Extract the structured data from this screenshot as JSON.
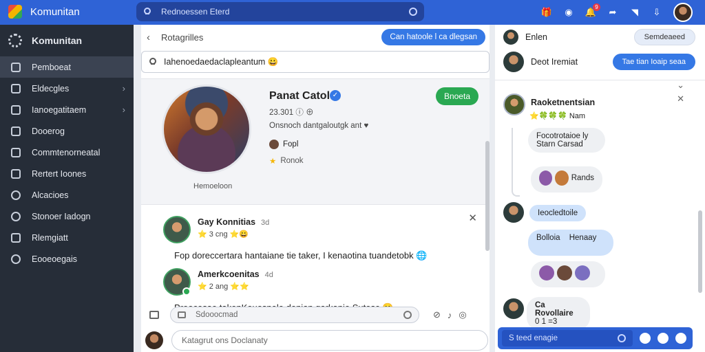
{
  "app": {
    "title": "Komunitan"
  },
  "search": {
    "placeholder": "Rednoessen Eterd"
  },
  "topbar": {
    "icons": [
      "gift-icon",
      "camera-icon",
      "notification-icon",
      "share-icon",
      "bookmark-icon",
      "download-icon"
    ],
    "notification_count": "9"
  },
  "sidebar": {
    "brand": "Komunitan",
    "items": [
      {
        "label": "Pemboeat",
        "icon": "home-icon"
      },
      {
        "label": "Eldecgles",
        "icon": "tag-icon",
        "chevron": "›"
      },
      {
        "label": "Ianoegatitaem",
        "icon": "calendar-icon",
        "chevron": "›"
      },
      {
        "label": "Dooerog",
        "icon": "chat-icon"
      },
      {
        "label": "Commtenorneatal",
        "icon": "video-icon"
      },
      {
        "label": "Rertert Ioones",
        "icon": "grid-icon"
      },
      {
        "label": "Alcacioes",
        "icon": "drop-icon"
      },
      {
        "label": "Stonoer Iadogn",
        "icon": "settings-icon"
      },
      {
        "label": "Rlemgiatt",
        "icon": "flag-icon"
      },
      {
        "label": "Eooeoegais",
        "icon": "info-icon"
      }
    ]
  },
  "main": {
    "breadcrumb": "Rotagrilles",
    "top_button": "Can  hatoole l ca dlegsan",
    "search_value": "Iahenoedaedaclapleantum 😀",
    "profile": {
      "name": "Panat Catolo",
      "stat": "23.301 ⓘ ⊕",
      "bio": "Onsnoch dantgaloutgk ant ♥",
      "row1": "Fopl",
      "row2": "Ronok",
      "avatar_caption": "Hemoeloon",
      "follow": "Bnoeta"
    },
    "posts": [
      {
        "name": "Gay Konnitias",
        "time": "3d",
        "meta": "⭐ 3 cng  ⭐😀",
        "text": "Fop doreccertara hantaiane tie taker, I kenaotina tuandetobk 🌐"
      },
      {
        "name": "Amerkcoenitas",
        "time": "4d",
        "meta": "⭐ 2 ang  ⭐⭐",
        "text": "Preocesae takenKouosnele denian garkanie Sutesc 😀"
      }
    ],
    "composer_placeholder": "Sdooocmad",
    "reply_placeholder": "Katagrut ons Doclanaty"
  },
  "chat": {
    "header_name": "Enlen",
    "header_button": "Semdeaeed",
    "row2_name": "Deot Iremiat",
    "row2_button": "Tae  tian Ioaip seaa",
    "rec_title": "Raoketnentsian",
    "rec_sub": "⭐🍀🍀🍀  Nam",
    "bubble1_line1": "Focotrotaioe ly",
    "bubble1_line2": "Starn Carsad",
    "bubble2_label": "Rands",
    "msg1": "Ieocledtoile",
    "msg2": "Bolloia",
    "msg2b": "Henaay",
    "last_name": "Ca Rovollaire",
    "last_meta": "0 1 =3",
    "input_placeholder": "S teed enagie"
  },
  "colors": {
    "accent": "#2f63d6",
    "sidebar": "#262d38",
    "follow": "#2aa852",
    "pill": "#3578e5"
  }
}
